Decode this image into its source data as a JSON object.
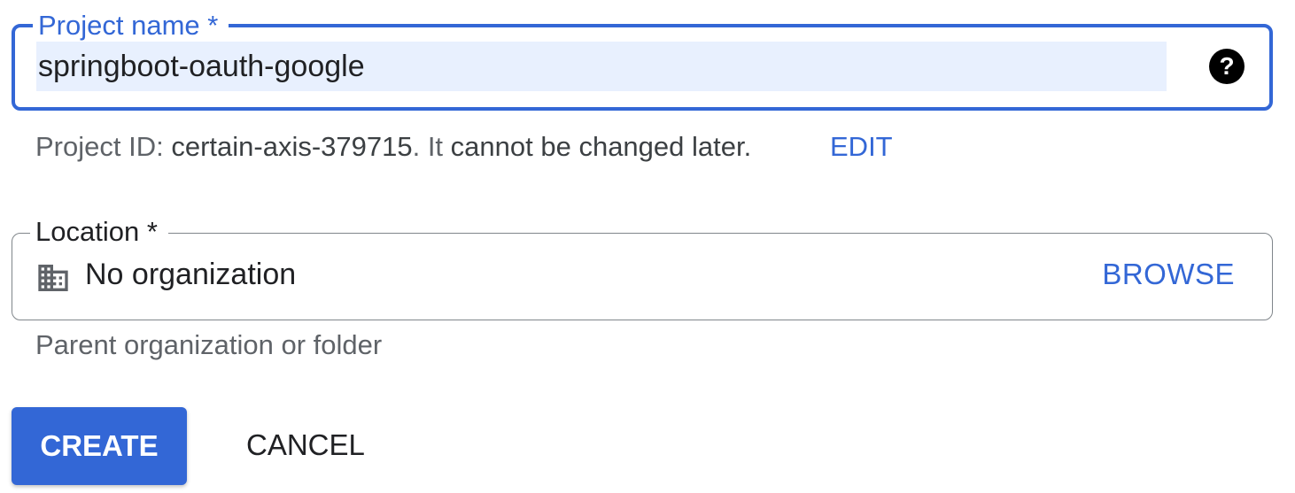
{
  "project_name": {
    "label": "Project name *",
    "value": "springboot-oauth-google",
    "help_icon": "help-circle-icon"
  },
  "project_id": {
    "prefix": "Project ID: ",
    "id": "certain-axis-379715",
    "middle": ". It ",
    "suffix": "cannot be changed later.",
    "edit_label": "EDIT"
  },
  "location": {
    "label": "Location *",
    "icon": "building-icon",
    "value": "No organization",
    "browse_label": "BROWSE",
    "hint": "Parent organization or folder"
  },
  "actions": {
    "create_label": "CREATE",
    "cancel_label": "CANCEL"
  },
  "colors": {
    "accent": "#3367d6",
    "input_highlight": "#e8f0fe"
  }
}
